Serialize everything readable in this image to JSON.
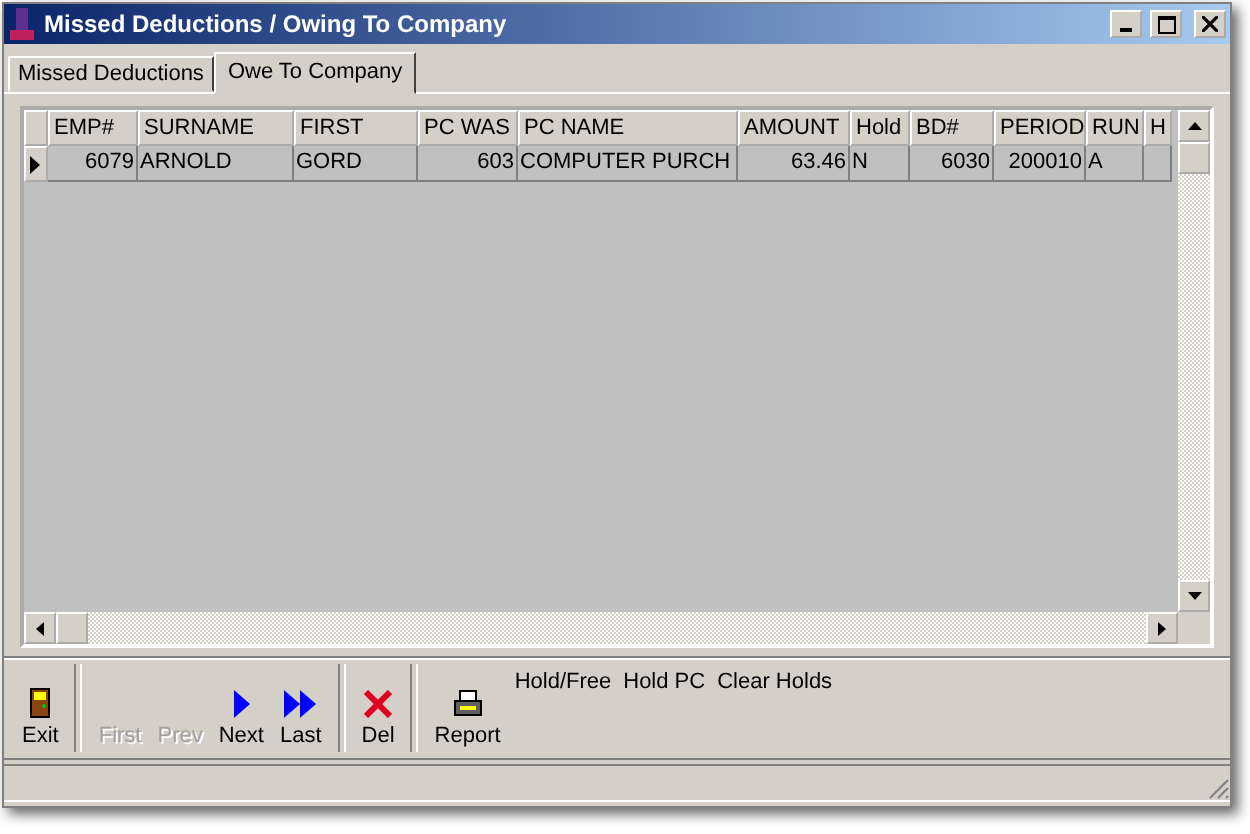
{
  "window": {
    "title": "Missed Deductions / Owing To Company"
  },
  "tabs": [
    {
      "label": "Missed Deductions",
      "selected": false
    },
    {
      "label": "Owe To Company",
      "selected": true
    }
  ],
  "table": {
    "columns": [
      {
        "label": "EMP#",
        "kind": "number"
      },
      {
        "label": "SURNAME",
        "kind": "text"
      },
      {
        "label": "FIRST",
        "kind": "text"
      },
      {
        "label": "PC WAS",
        "kind": "number"
      },
      {
        "label": "PC NAME",
        "kind": "text"
      },
      {
        "label": "AMOUNT",
        "kind": "number"
      },
      {
        "label": "Hold",
        "kind": "text"
      },
      {
        "label": "BD#",
        "kind": "number"
      },
      {
        "label": "PERIOD",
        "kind": "number"
      },
      {
        "label": "RUN",
        "kind": "text"
      },
      {
        "label": "H",
        "kind": "text"
      }
    ],
    "rows": [
      {
        "selected": true,
        "cells": [
          "6079",
          "ARNOLD",
          "GORD",
          "603",
          "COMPUTER PURCH",
          "63.46",
          "N",
          "6030",
          "200010",
          "A",
          ""
        ]
      }
    ]
  },
  "toolbar": [
    {
      "kind": "exit",
      "label": "Exit",
      "disabled": false
    },
    {
      "kind": "separator"
    },
    {
      "kind": "plain",
      "label": "First",
      "disabled": true
    },
    {
      "kind": "plain",
      "label": "Prev",
      "disabled": true
    },
    {
      "kind": "next",
      "label": "Next",
      "disabled": false
    },
    {
      "kind": "last",
      "label": "Last",
      "disabled": false
    },
    {
      "kind": "separator"
    },
    {
      "kind": "delete",
      "label": "Del",
      "disabled": false
    },
    {
      "kind": "separator"
    },
    {
      "kind": "report",
      "label": "Report",
      "disabled": false
    }
  ],
  "actions": [
    {
      "label": "Hold/Free"
    },
    {
      "label": "Hold PC"
    },
    {
      "label": "Clear Holds"
    }
  ]
}
